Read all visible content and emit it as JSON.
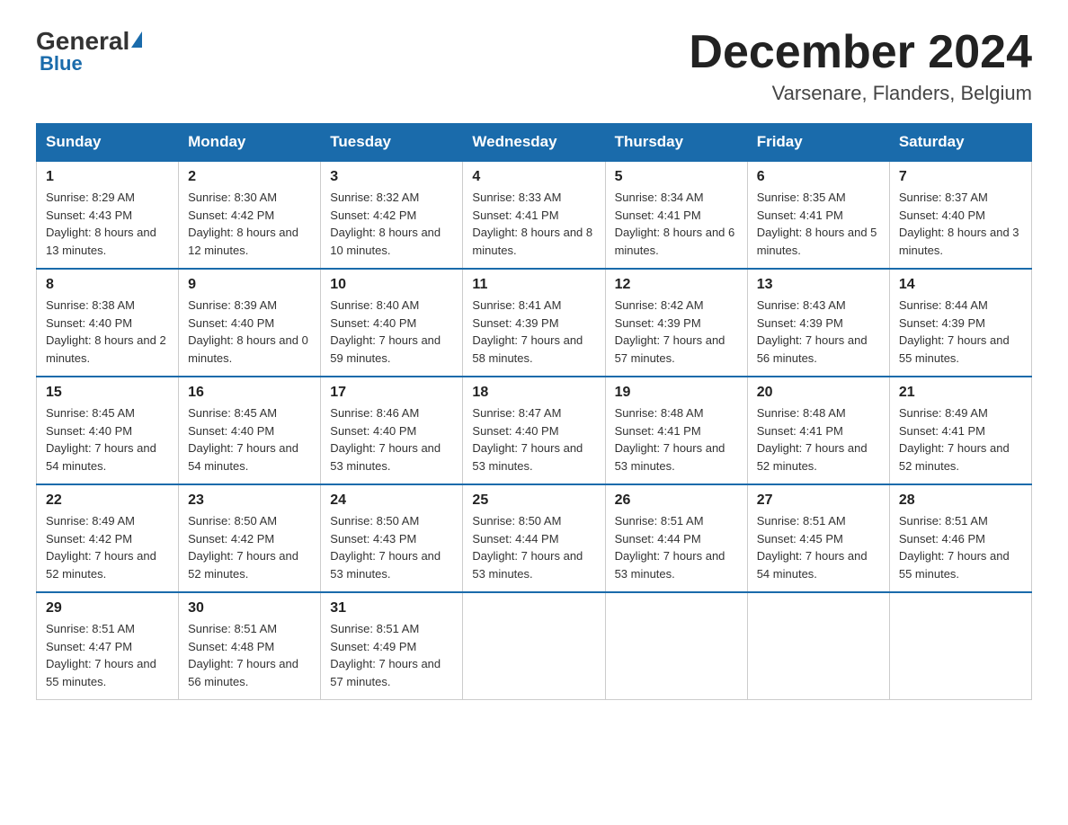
{
  "logo": {
    "general": "General",
    "blue": "Blue"
  },
  "header": {
    "month": "December 2024",
    "location": "Varsenare, Flanders, Belgium"
  },
  "days_of_week": [
    "Sunday",
    "Monday",
    "Tuesday",
    "Wednesday",
    "Thursday",
    "Friday",
    "Saturday"
  ],
  "weeks": [
    [
      {
        "day": "1",
        "sunrise": "8:29 AM",
        "sunset": "4:43 PM",
        "daylight": "8 hours and 13 minutes."
      },
      {
        "day": "2",
        "sunrise": "8:30 AM",
        "sunset": "4:42 PM",
        "daylight": "8 hours and 12 minutes."
      },
      {
        "day": "3",
        "sunrise": "8:32 AM",
        "sunset": "4:42 PM",
        "daylight": "8 hours and 10 minutes."
      },
      {
        "day": "4",
        "sunrise": "8:33 AM",
        "sunset": "4:41 PM",
        "daylight": "8 hours and 8 minutes."
      },
      {
        "day": "5",
        "sunrise": "8:34 AM",
        "sunset": "4:41 PM",
        "daylight": "8 hours and 6 minutes."
      },
      {
        "day": "6",
        "sunrise": "8:35 AM",
        "sunset": "4:41 PM",
        "daylight": "8 hours and 5 minutes."
      },
      {
        "day": "7",
        "sunrise": "8:37 AM",
        "sunset": "4:40 PM",
        "daylight": "8 hours and 3 minutes."
      }
    ],
    [
      {
        "day": "8",
        "sunrise": "8:38 AM",
        "sunset": "4:40 PM",
        "daylight": "8 hours and 2 minutes."
      },
      {
        "day": "9",
        "sunrise": "8:39 AM",
        "sunset": "4:40 PM",
        "daylight": "8 hours and 0 minutes."
      },
      {
        "day": "10",
        "sunrise": "8:40 AM",
        "sunset": "4:40 PM",
        "daylight": "7 hours and 59 minutes."
      },
      {
        "day": "11",
        "sunrise": "8:41 AM",
        "sunset": "4:39 PM",
        "daylight": "7 hours and 58 minutes."
      },
      {
        "day": "12",
        "sunrise": "8:42 AM",
        "sunset": "4:39 PM",
        "daylight": "7 hours and 57 minutes."
      },
      {
        "day": "13",
        "sunrise": "8:43 AM",
        "sunset": "4:39 PM",
        "daylight": "7 hours and 56 minutes."
      },
      {
        "day": "14",
        "sunrise": "8:44 AM",
        "sunset": "4:39 PM",
        "daylight": "7 hours and 55 minutes."
      }
    ],
    [
      {
        "day": "15",
        "sunrise": "8:45 AM",
        "sunset": "4:40 PM",
        "daylight": "7 hours and 54 minutes."
      },
      {
        "day": "16",
        "sunrise": "8:45 AM",
        "sunset": "4:40 PM",
        "daylight": "7 hours and 54 minutes."
      },
      {
        "day": "17",
        "sunrise": "8:46 AM",
        "sunset": "4:40 PM",
        "daylight": "7 hours and 53 minutes."
      },
      {
        "day": "18",
        "sunrise": "8:47 AM",
        "sunset": "4:40 PM",
        "daylight": "7 hours and 53 minutes."
      },
      {
        "day": "19",
        "sunrise": "8:48 AM",
        "sunset": "4:41 PM",
        "daylight": "7 hours and 53 minutes."
      },
      {
        "day": "20",
        "sunrise": "8:48 AM",
        "sunset": "4:41 PM",
        "daylight": "7 hours and 52 minutes."
      },
      {
        "day": "21",
        "sunrise": "8:49 AM",
        "sunset": "4:41 PM",
        "daylight": "7 hours and 52 minutes."
      }
    ],
    [
      {
        "day": "22",
        "sunrise": "8:49 AM",
        "sunset": "4:42 PM",
        "daylight": "7 hours and 52 minutes."
      },
      {
        "day": "23",
        "sunrise": "8:50 AM",
        "sunset": "4:42 PM",
        "daylight": "7 hours and 52 minutes."
      },
      {
        "day": "24",
        "sunrise": "8:50 AM",
        "sunset": "4:43 PM",
        "daylight": "7 hours and 53 minutes."
      },
      {
        "day": "25",
        "sunrise": "8:50 AM",
        "sunset": "4:44 PM",
        "daylight": "7 hours and 53 minutes."
      },
      {
        "day": "26",
        "sunrise": "8:51 AM",
        "sunset": "4:44 PM",
        "daylight": "7 hours and 53 minutes."
      },
      {
        "day": "27",
        "sunrise": "8:51 AM",
        "sunset": "4:45 PM",
        "daylight": "7 hours and 54 minutes."
      },
      {
        "day": "28",
        "sunrise": "8:51 AM",
        "sunset": "4:46 PM",
        "daylight": "7 hours and 55 minutes."
      }
    ],
    [
      {
        "day": "29",
        "sunrise": "8:51 AM",
        "sunset": "4:47 PM",
        "daylight": "7 hours and 55 minutes."
      },
      {
        "day": "30",
        "sunrise": "8:51 AM",
        "sunset": "4:48 PM",
        "daylight": "7 hours and 56 minutes."
      },
      {
        "day": "31",
        "sunrise": "8:51 AM",
        "sunset": "4:49 PM",
        "daylight": "7 hours and 57 minutes."
      },
      null,
      null,
      null,
      null
    ]
  ],
  "labels": {
    "sunrise": "Sunrise:",
    "sunset": "Sunset:",
    "daylight": "Daylight:"
  }
}
